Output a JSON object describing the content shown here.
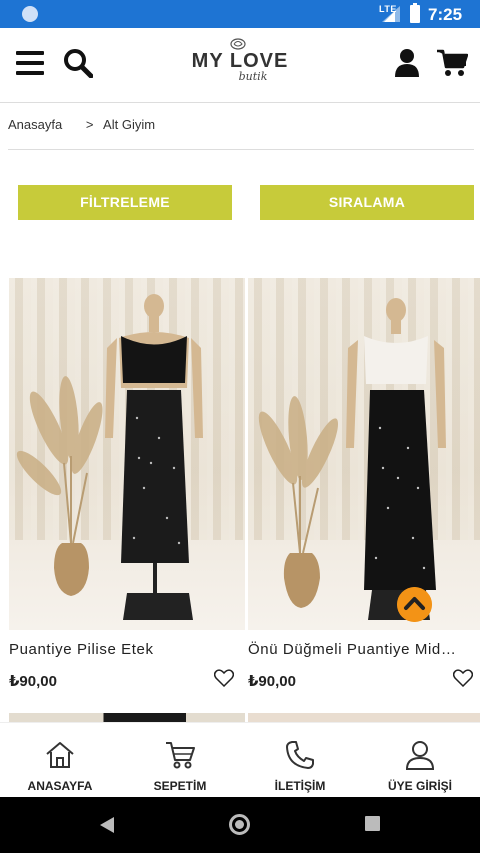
{
  "status_bar": {
    "network": "LTE",
    "time": "7:25"
  },
  "header": {
    "logo_title": "MY LOVE",
    "logo_subtitle": "butik"
  },
  "breadcrumb": {
    "home": "Anasayfa",
    "separator": ">",
    "current": "Alt Giyim"
  },
  "actions": {
    "filter_label": "FİLTRELEME",
    "sort_label": "SIRALAMA"
  },
  "products": [
    {
      "name": "Puantiye Pilise Etek",
      "price": "₺90,00"
    },
    {
      "name": "Önü Düğmeli Puantiye Midi Etek",
      "price": "₺90,00"
    }
  ],
  "bottom_nav": {
    "home": "ANASAYFA",
    "cart": "SEPETİM",
    "contact": "İLETİŞİM",
    "login": "ÜYE GİRİŞİ"
  },
  "colors": {
    "status_bar": "#1e74d3",
    "accent_button": "#c7cb3a",
    "scroll_top_button": "#f39316"
  },
  "icons": {
    "header": [
      "menu-icon",
      "search-icon",
      "user-icon",
      "cart-icon"
    ],
    "bottom_nav": [
      "home-icon",
      "cart-icon",
      "phone-icon",
      "user-icon"
    ]
  }
}
